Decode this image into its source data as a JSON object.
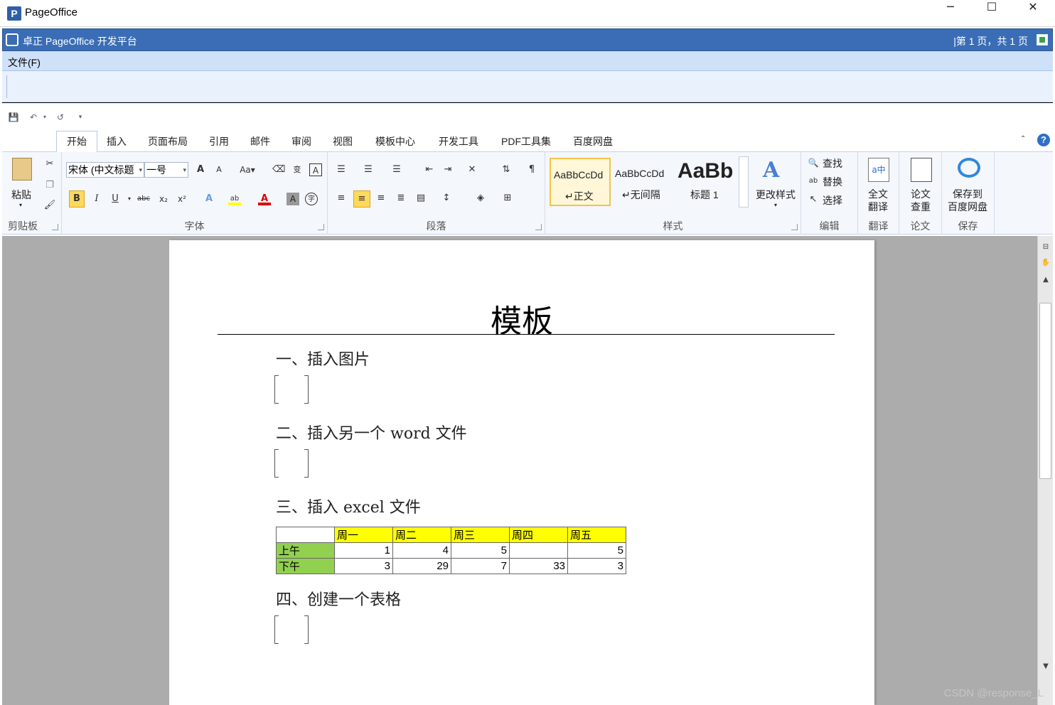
{
  "window": {
    "title": "PageOffice",
    "minimize": "─",
    "maximize": "☐",
    "close": "✕"
  },
  "pobar": {
    "title": "卓正 PageOffice 开发平台",
    "page_info": "|第 1 页，共 1 页"
  },
  "menu": {
    "file": "文件(F)"
  },
  "tabs": [
    "开始",
    "插入",
    "页面布局",
    "引用",
    "邮件",
    "审阅",
    "视图",
    "模板中心",
    "开发工具",
    "PDF工具集",
    "百度网盘"
  ],
  "ribbon": {
    "clipboard": {
      "paste": "粘贴",
      "label": "剪贴板"
    },
    "font": {
      "name": "宋体 (中文标题",
      "size": "一号",
      "label": "字体"
    },
    "paragraph": {
      "label": "段落"
    },
    "styles": {
      "items": [
        {
          "preview": "AaBbCcDd",
          "name": "↵正文"
        },
        {
          "preview": "AaBbCcDd",
          "name": "↵无间隔"
        },
        {
          "preview": "AaBb",
          "name": "标题 1"
        }
      ],
      "change": "更改样式",
      "label": "样式"
    },
    "editing": {
      "find": "查找",
      "replace": "替换",
      "select": "选择",
      "label": "编辑"
    },
    "translate": {
      "full": "全文\n翻译",
      "label": "翻译"
    },
    "paper": {
      "check": "论文\n查重",
      "label": "论文"
    },
    "save": {
      "btn": "保存到\n百度网盘",
      "label": "保存"
    }
  },
  "document": {
    "title": "模板",
    "sections": [
      "一、插入图片",
      "二、插入另一个 word 文件",
      "三、插入 excel 文件",
      "四、创建一个表格"
    ],
    "excel": {
      "header": [
        "",
        "周一",
        "周二",
        "周三",
        "周四",
        "周五"
      ],
      "rows": [
        {
          "label": "上午",
          "values": [
            "1",
            "4",
            "5",
            "",
            "5"
          ]
        },
        {
          "label": "下午",
          "values": [
            "3",
            "29",
            "7",
            "33",
            "3"
          ]
        }
      ]
    }
  },
  "watermark": "CSDN @response_L"
}
